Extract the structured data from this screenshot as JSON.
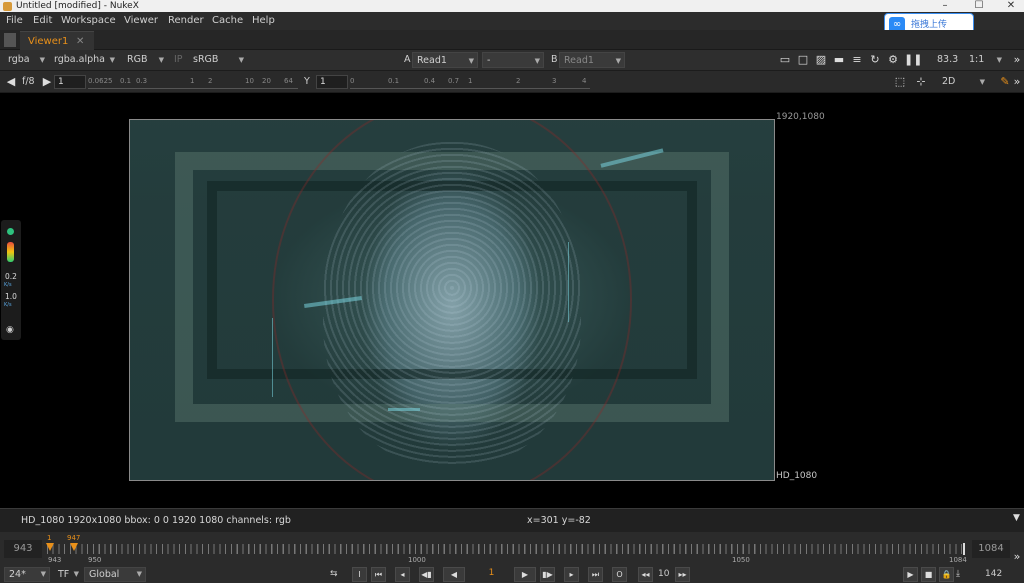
{
  "window": {
    "title": "Untitled [modified] - NukeX",
    "min": "–",
    "max": "☐",
    "close": "✕"
  },
  "menu": [
    "File",
    "Edit",
    "Workspace",
    "Viewer",
    "Render",
    "Cache",
    "Help"
  ],
  "upload_button": {
    "label": "拖拽上传"
  },
  "tab": {
    "label": "Viewer1",
    "close": "✕"
  },
  "toolbar1": {
    "channels": "rgba",
    "alpha": "rgba.alpha",
    "display": "RGB",
    "ip": "IP",
    "lut": "sRGB",
    "a_label": "A",
    "a_input": "Read1",
    "compare": "-",
    "b_label": "B",
    "b_input": "Read1",
    "zoom": "83.3",
    "ratio": "1:1"
  },
  "toolbar2": {
    "fstop": "f/8",
    "gain": "1",
    "gain_ticks": [
      "0.0625",
      "0.1",
      "0.3",
      "1",
      "2",
      "10",
      "20",
      "64"
    ],
    "gamma_label": "Y",
    "gamma": "1",
    "gamma_ticks": [
      "0",
      "0.1",
      "0.4",
      "0.7",
      "1",
      "2",
      "3",
      "4"
    ],
    "view_mode": "2D"
  },
  "viewer": {
    "format_top_right": "1920,1080",
    "format_bottom_right": "HD_1080"
  },
  "sidepanel": {
    "val1": "0.2",
    "unit1": "K/s",
    "val2": "1.0",
    "unit2": "K/s"
  },
  "infobar": {
    "info": "HD_1080 1920x1080  bbox: 0 0 1920 1080 channels: rgb",
    "coords": "x=301 y=-82"
  },
  "timeline": {
    "in_frame": "943",
    "out_frame": "1084",
    "in_marker": "1",
    "current_marker": "947",
    "ticks": [
      "943",
      "950",
      "1000",
      "1050",
      "1084"
    ]
  },
  "transport": {
    "fps": "24*",
    "tf": "TF",
    "scope": "Global",
    "frame": "1",
    "increment": "10",
    "end": "142"
  },
  "colors": {
    "accent": "#e8901a",
    "bg": "#2b2b2b",
    "viewer_bg": "#000000"
  }
}
